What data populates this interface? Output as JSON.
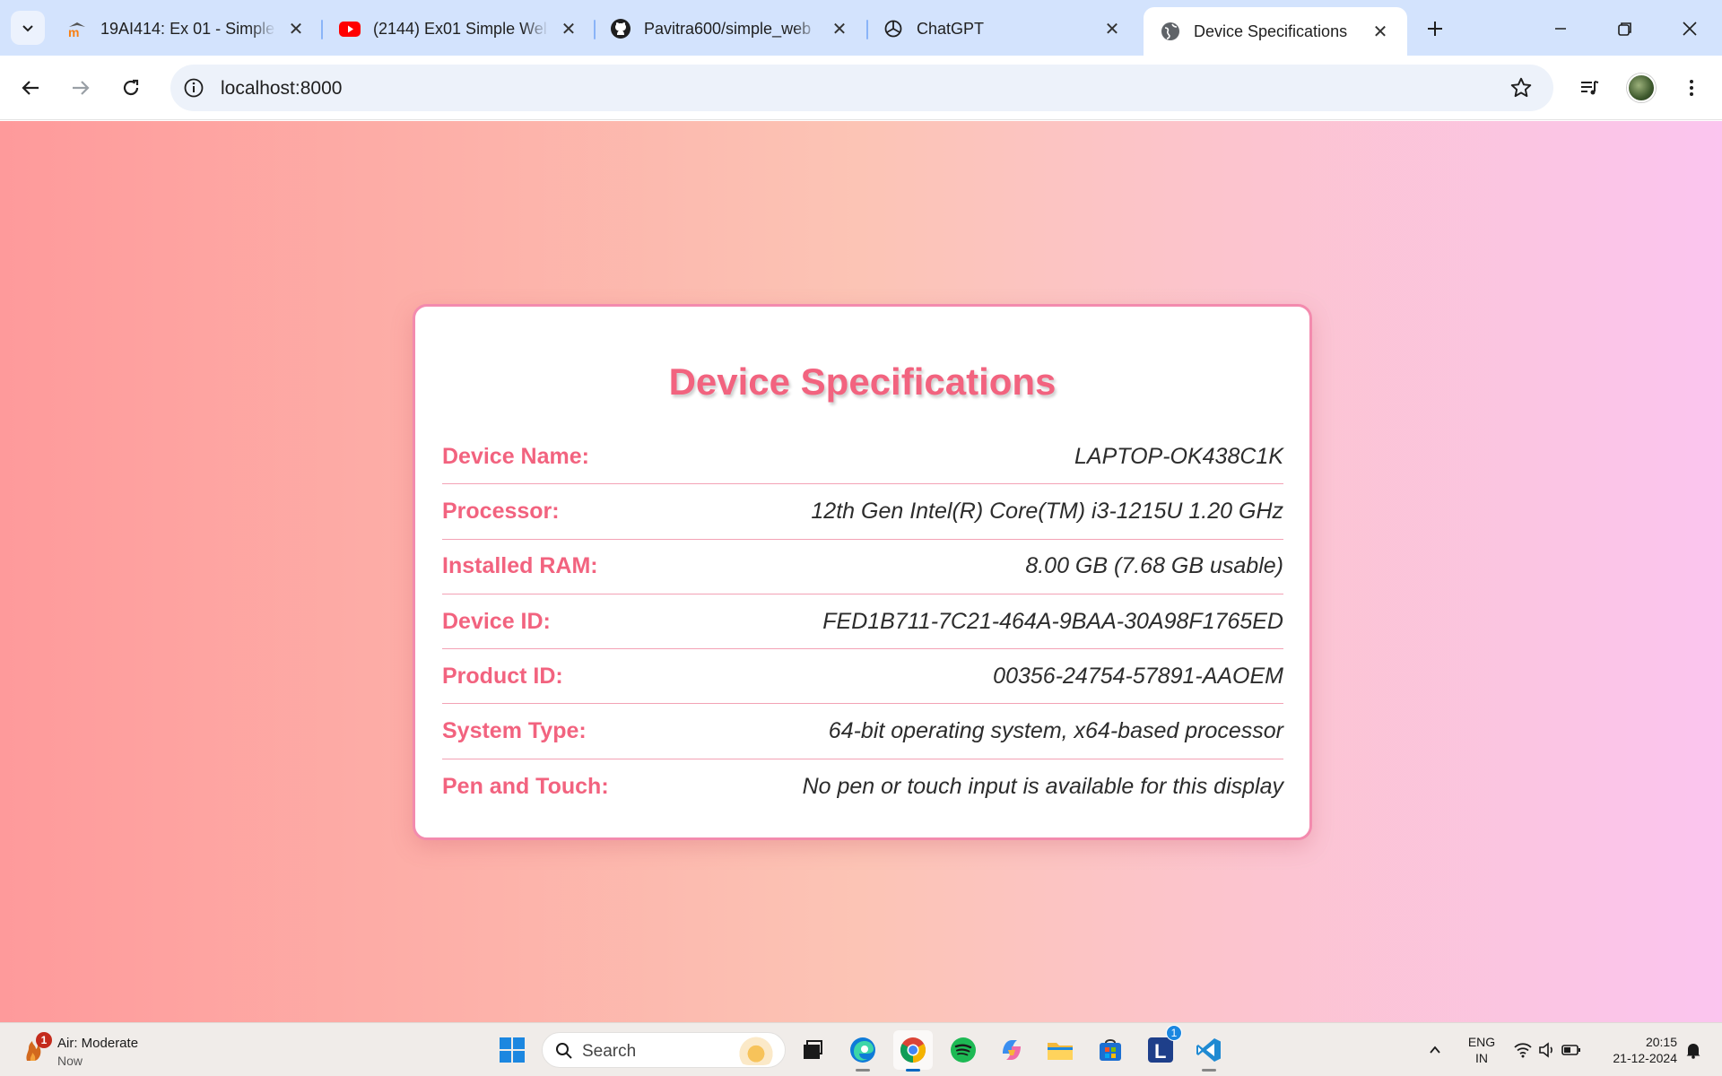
{
  "browser": {
    "tabs": [
      {
        "title": "19AI414: Ex 01 - Simple",
        "icon": "moodle-icon"
      },
      {
        "title": "(2144) Ex01 Simple Wel",
        "icon": "youtube-icon"
      },
      {
        "title": "Pavitra600/simple_web",
        "icon": "github-icon"
      },
      {
        "title": "ChatGPT",
        "icon": "chatgpt-icon"
      },
      {
        "title": "Device Specifications",
        "icon": "globe-icon"
      }
    ],
    "url": "localhost:8000"
  },
  "page": {
    "title": "Device Specifications",
    "specs": [
      {
        "label": "Device Name:",
        "value": "LAPTOP-OK438C1K"
      },
      {
        "label": "Processor:",
        "value": "12th Gen Intel(R) Core(TM) i3-1215U 1.20 GHz"
      },
      {
        "label": "Installed RAM:",
        "value": "8.00 GB (7.68 GB usable)"
      },
      {
        "label": "Device ID:",
        "value": "FED1B711-7C21-464A-9BAA-30A98F1765ED"
      },
      {
        "label": "Product ID:",
        "value": "00356-24754-57891-AAOEM"
      },
      {
        "label": "System Type:",
        "value": "64-bit operating system, x64-based processor"
      },
      {
        "label": "Pen and Touch:",
        "value": "No pen or touch input is available for this display"
      }
    ]
  },
  "taskbar": {
    "weather": {
      "title": "Air: Moderate",
      "subtitle": "Now",
      "badge": "1"
    },
    "search_label": "Search",
    "lang_line1": "ENG",
    "lang_line2": "IN",
    "time": "20:15",
    "date": "21-12-2024",
    "lexicon_badge": "1"
  },
  "colors": {
    "accent": "#f2637f",
    "card_border": "#f38bae",
    "bg_left": "#fe9a9b",
    "bg_right": "#fbc5ef"
  }
}
